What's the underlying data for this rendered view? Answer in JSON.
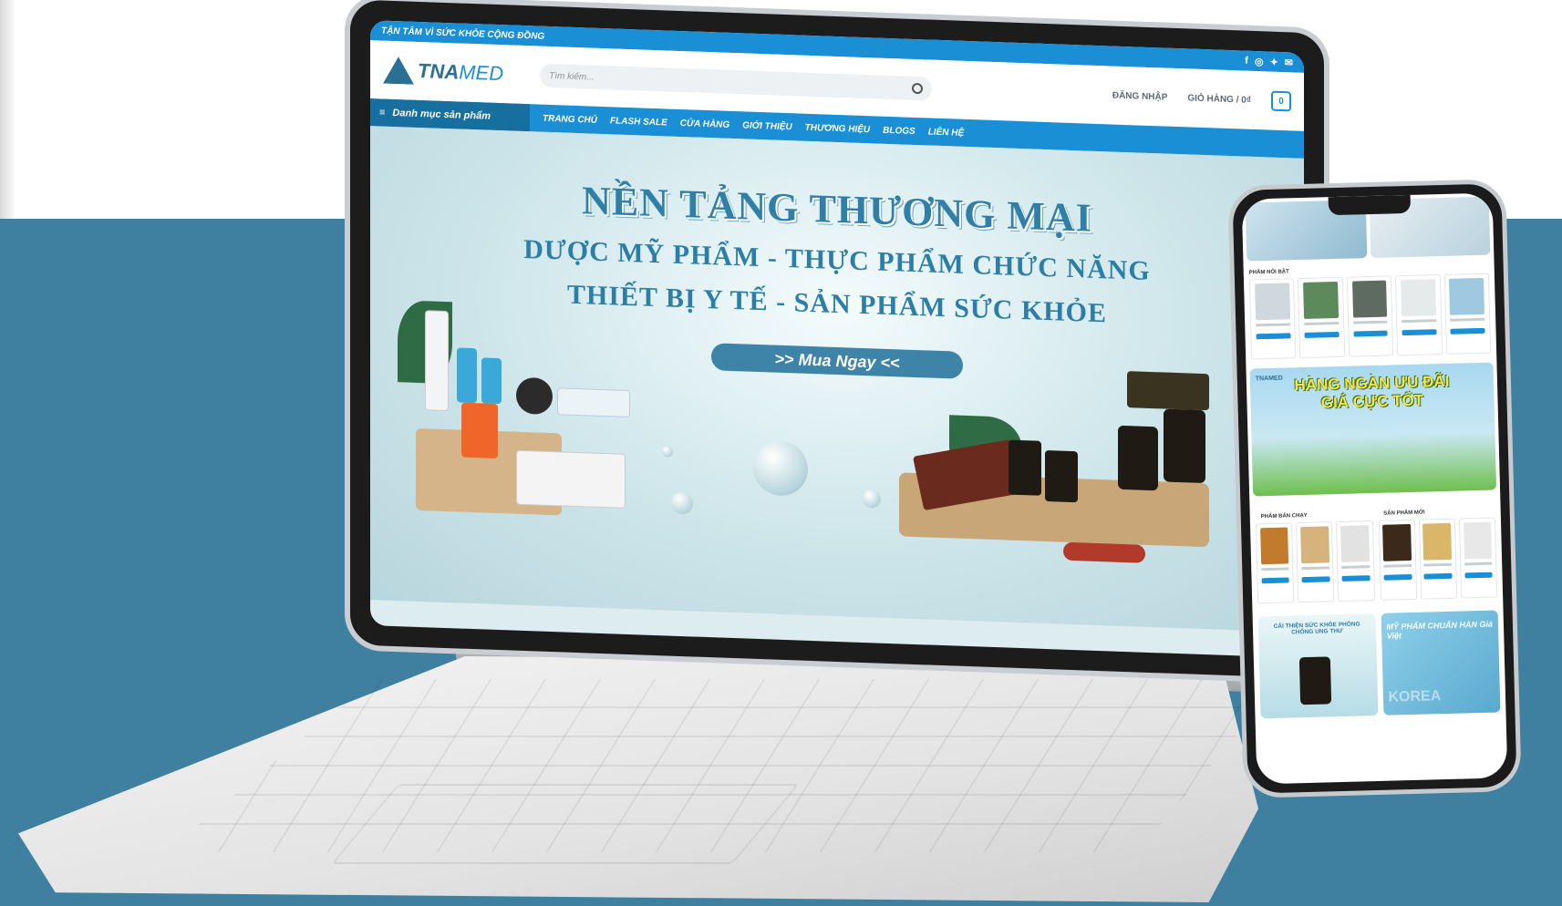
{
  "site": {
    "tagline": "TẬN TÂM VÌ SỨC KHỎE CỘNG ĐỒNG",
    "logo": {
      "part1": "TNA",
      "part2": "MED"
    },
    "search_placeholder": "Tìm kiếm...",
    "login_label": "ĐĂNG NHẬP",
    "cart_label": "GIỎ HÀNG / 0₫",
    "cart_count": "0",
    "social_icons": [
      "facebook-icon",
      "instagram-icon",
      "twitter-icon",
      "email-icon"
    ]
  },
  "nav": {
    "category_label": "Danh mục sản phẩm",
    "items": [
      "TRANG CHỦ",
      "FLASH SALE",
      "CỬA HÀNG",
      "GIỚI THIỆU",
      "THƯƠNG HIỆU",
      "BLOGS",
      "LIÊN HỆ"
    ]
  },
  "hero": {
    "title": "NỀN TẢNG THƯƠNG MẠI",
    "line1": "DƯỢC MỸ PHẨM - THỰC PHẨM CHỨC NĂNG",
    "line2": "THIẾT BỊ Y TẾ - SẢN PHẨM SỨC KHỎE",
    "cta": ">> Mua Ngay <<"
  },
  "mobile": {
    "section_featured": "PHẨM NỔI BẬT",
    "promo_brand": "TNAMED",
    "promo_title_line1": "HÀNG NGÀN ƯU ĐÃI",
    "promo_title_line2": "GIÁ CỰC TỐT",
    "section_bestseller": "PHẨM BÁN CHẠY",
    "section_new": "SẢN PHẨM MỚI",
    "banner_left_caption": "CẢI THIỆN SỨC KHỎE PHÒNG CHỐNG UNG THƯ",
    "banner_right_caption": "MỸ PHẨM CHUẨN HÀN Giá Việt",
    "banner_right_watermark": "KOREA"
  },
  "colors": {
    "brand_blue": "#1a8fd6",
    "brand_dark": "#2c6f94",
    "background_band": "#3f80a0"
  }
}
